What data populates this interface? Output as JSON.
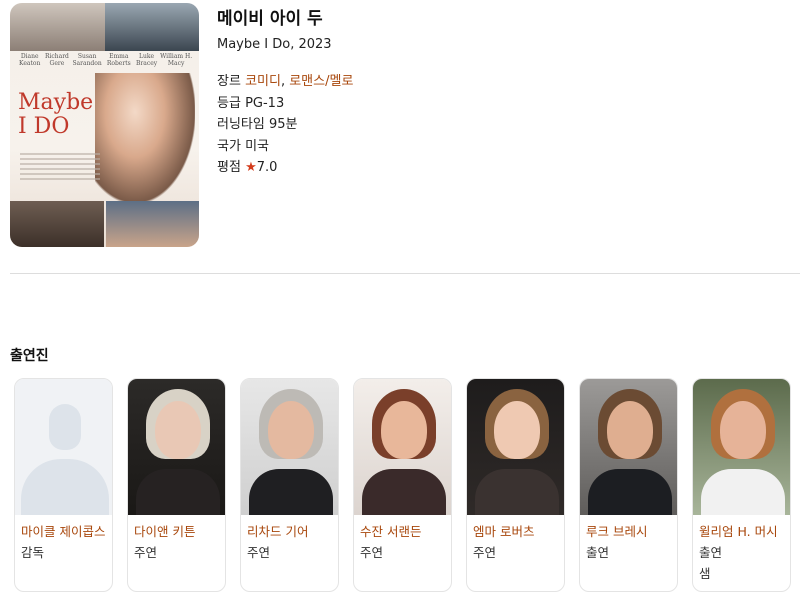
{
  "movie": {
    "title": "메이비 아이 두",
    "original": "Maybe I Do, 2023",
    "poster": {
      "title_line1": "Maybe",
      "title_line2": "I DO",
      "names": [
        "Diane Keaton",
        "Richard Gere",
        "Susan Sarandon",
        "Emma Roberts",
        "Luke Bracey",
        "William H. Macy"
      ]
    },
    "genre_label": "장르",
    "genres": [
      "코미디",
      "로맨스/멜로"
    ],
    "genre_sep": ", ",
    "rating_label": "등급",
    "rating": "PG-13",
    "runtime_label": "러닝타임",
    "runtime": "95분",
    "country_label": "국가",
    "country": "미국",
    "score_label": "평점",
    "score_star": "★",
    "score": "7.0"
  },
  "cast_section": {
    "heading": "출연진",
    "members": [
      {
        "name": "마이클 제이콥스",
        "role": "감독"
      },
      {
        "name": "다이앤 키튼",
        "role": "주연"
      },
      {
        "name": "리차드 기어",
        "role": "주연"
      },
      {
        "name": "수잔 서랜든",
        "role": "주연"
      },
      {
        "name": "엠마 로버츠",
        "role": "주연"
      },
      {
        "name": "루크 브레시",
        "role": "출연"
      },
      {
        "name": "윌리엄 H. 머시",
        "role": "출연"
      }
    ],
    "extra_role": "샘"
  },
  "colors": {
    "link": "#a8470c",
    "star": "#d43c1c",
    "poster_title": "#c0392b"
  }
}
